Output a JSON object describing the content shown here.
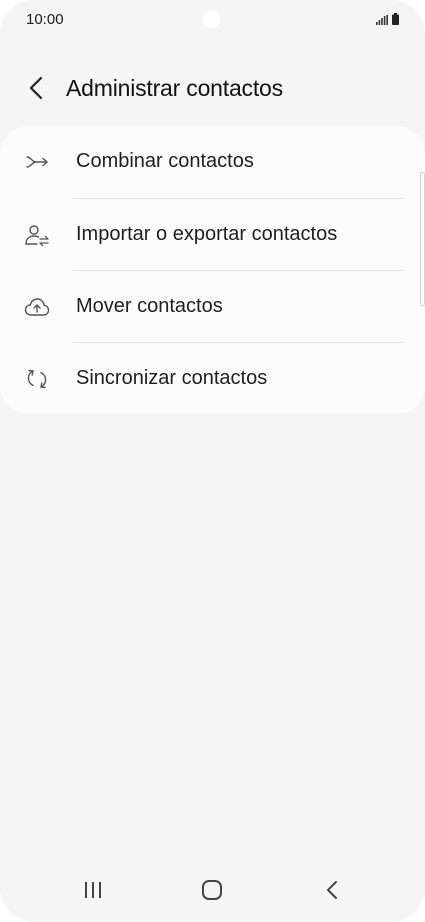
{
  "status_bar": {
    "time": "10:00"
  },
  "header": {
    "title": "Administrar contactos"
  },
  "menu": {
    "items": [
      {
        "label": "Combinar contactos",
        "icon": "merge-icon"
      },
      {
        "label": "Importar o exportar contactos",
        "icon": "import-export-icon"
      },
      {
        "label": "Mover contactos",
        "icon": "cloud-upload-icon"
      },
      {
        "label": "Sincronizar contactos",
        "icon": "sync-icon"
      }
    ]
  },
  "nav_bar": {
    "buttons": [
      "recents-icon",
      "home-icon",
      "back-icon"
    ]
  },
  "colors": {
    "background": "#f5f5f5",
    "card": "#fcfcfc",
    "text": "#1f1f1f",
    "icon": "#555555",
    "divider": "#e2e2e2"
  }
}
